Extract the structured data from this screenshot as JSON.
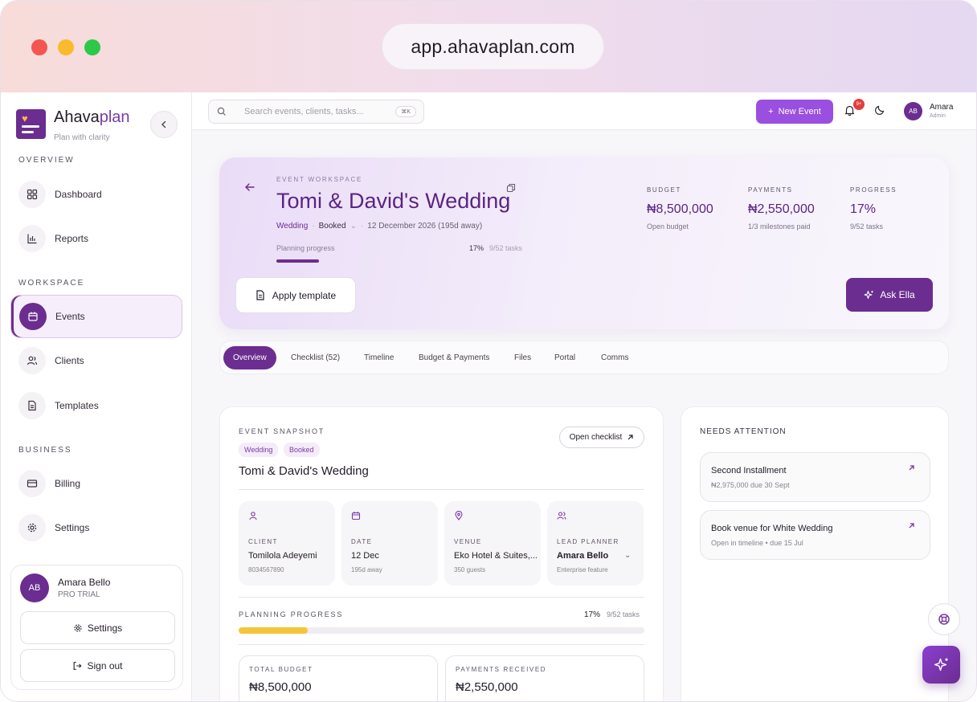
{
  "browser": {
    "url": "app.ahavaplan.com"
  },
  "brand": {
    "name_main": "Ahava",
    "name_accent": "plan",
    "tagline": "Plan with clarity"
  },
  "sidebar": {
    "sections": {
      "overview": "OVERVIEW",
      "workspace": "WORKSPACE",
      "business": "BUSINESS"
    },
    "items": [
      {
        "label": "Dashboard",
        "icon": "grid-icon"
      },
      {
        "label": "Reports",
        "icon": "bar-chart-icon"
      },
      {
        "label": "Events",
        "icon": "calendar-icon",
        "active": true
      },
      {
        "label": "Clients",
        "icon": "users-icon"
      },
      {
        "label": "Templates",
        "icon": "document-icon"
      },
      {
        "label": "Billing",
        "icon": "credit-card-icon"
      },
      {
        "label": "Settings",
        "icon": "gear-icon"
      }
    ],
    "user": {
      "initials": "AB",
      "name": "Amara Bello",
      "plan": "PRO TRIAL",
      "settings_label": "Settings",
      "signout_label": "Sign out"
    }
  },
  "topbar": {
    "search_placeholder": "Search events, clients, tasks...",
    "search_shortcut": "⌘K",
    "new_event_label": "New Event",
    "notification_count": "9+",
    "user_initials": "AB",
    "user_name": "Amara",
    "user_role": "Admin"
  },
  "hero": {
    "eyebrow": "EVENT WORKSPACE",
    "title": "Tomi & David's Wedding",
    "type": "Wedding",
    "status": "Booked",
    "date": "12 December 2026 (195d away)",
    "progress_label": "Planning progress",
    "progress_pct": "17%",
    "progress_tasks": "9/52 tasks",
    "progress_value": 0.17,
    "stats": [
      {
        "label": "BUDGET",
        "value": "₦8,500,000",
        "sub": "Open budget"
      },
      {
        "label": "PAYMENTS",
        "value": "₦2,550,000",
        "sub": "1/3 milestones paid"
      },
      {
        "label": "PROGRESS",
        "value": "17%",
        "sub": "9/52 tasks"
      }
    ],
    "apply_template_label": "Apply template",
    "ask_ella_label": "Ask Ella"
  },
  "tabs": [
    {
      "label": "Overview",
      "active": true
    },
    {
      "label": "Checklist (52)"
    },
    {
      "label": "Timeline"
    },
    {
      "label": "Budget & Payments"
    },
    {
      "label": "Files"
    },
    {
      "label": "Portal"
    },
    {
      "label": "Comms"
    }
  ],
  "snapshot": {
    "label": "EVENT SNAPSHOT",
    "chips": [
      "Wedding",
      "Booked"
    ],
    "title": "Tomi & David's Wedding",
    "open_checklist_label": "Open checklist",
    "tiles": [
      {
        "label": "CLIENT",
        "value": "Tomilola Adeyemi",
        "sub": "8034567890",
        "icon": "person-icon"
      },
      {
        "label": "DATE",
        "value": "12 Dec",
        "sub": "195d away",
        "icon": "calendar-icon"
      },
      {
        "label": "VENUE",
        "value": "Eko Hotel & Suites,...",
        "sub": "350 guests",
        "icon": "location-pin-icon"
      },
      {
        "label": "LEAD PLANNER",
        "value": "Amara Bello",
        "sub": "Enterprise feature",
        "icon": "users-icon"
      }
    ],
    "planning_label": "PLANNING PROGRESS",
    "planning_pct": "17%",
    "planning_tasks": "9/52 tasks",
    "planning_value": 0.17,
    "total_budget_label": "TOTAL BUDGET",
    "total_budget_value": "₦8,500,000",
    "payments_label": "PAYMENTS RECEIVED",
    "payments_value": "₦2,550,000"
  },
  "attention": {
    "label": "NEEDS ATTENTION",
    "items": [
      {
        "title": "Second Installment",
        "sub": "₦2,975,000 due 30 Sept"
      },
      {
        "title": "Book venue for White Wedding",
        "sub": "Open in timeline • due 15 Jul"
      }
    ]
  },
  "colors": {
    "brand_purple": "#6b2d8f",
    "cta_purple": "#9a4fe0",
    "progress_yellow": "#f4c53a",
    "badge_red": "#e23d3d"
  }
}
